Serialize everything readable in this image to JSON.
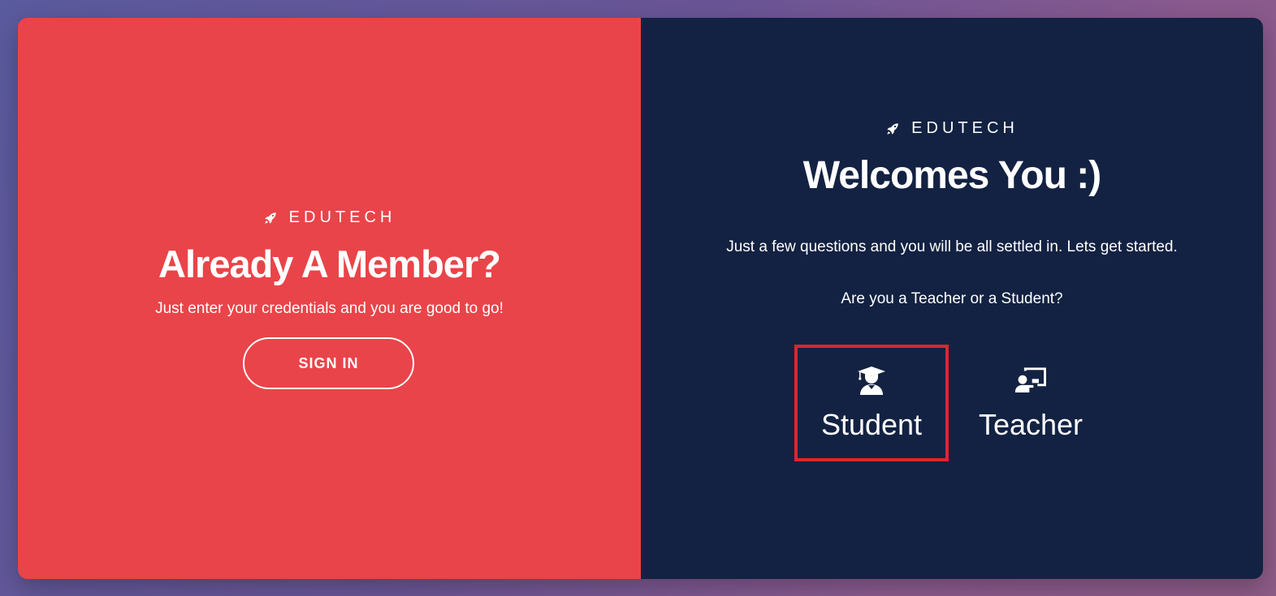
{
  "brand": {
    "name": "EDUTECH",
    "icon": "rocket-icon"
  },
  "left_panel": {
    "heading": "Already A Member?",
    "subtext": "Just enter your credentials and you are good to go!",
    "signin_label": "SIGN IN",
    "background_color": "#e94449"
  },
  "right_panel": {
    "heading": "Welcomes You :)",
    "intro": "Just a few questions and you will be all settled in. Lets get started.",
    "question": "Are you a Teacher or a Student?",
    "background_color": "#132242",
    "roles": [
      {
        "label": "Student",
        "icon": "graduate-icon",
        "selected": true
      },
      {
        "label": "Teacher",
        "icon": "teacher-board-icon",
        "selected": false
      }
    ]
  },
  "colors": {
    "selection_border": "#e0242e"
  }
}
